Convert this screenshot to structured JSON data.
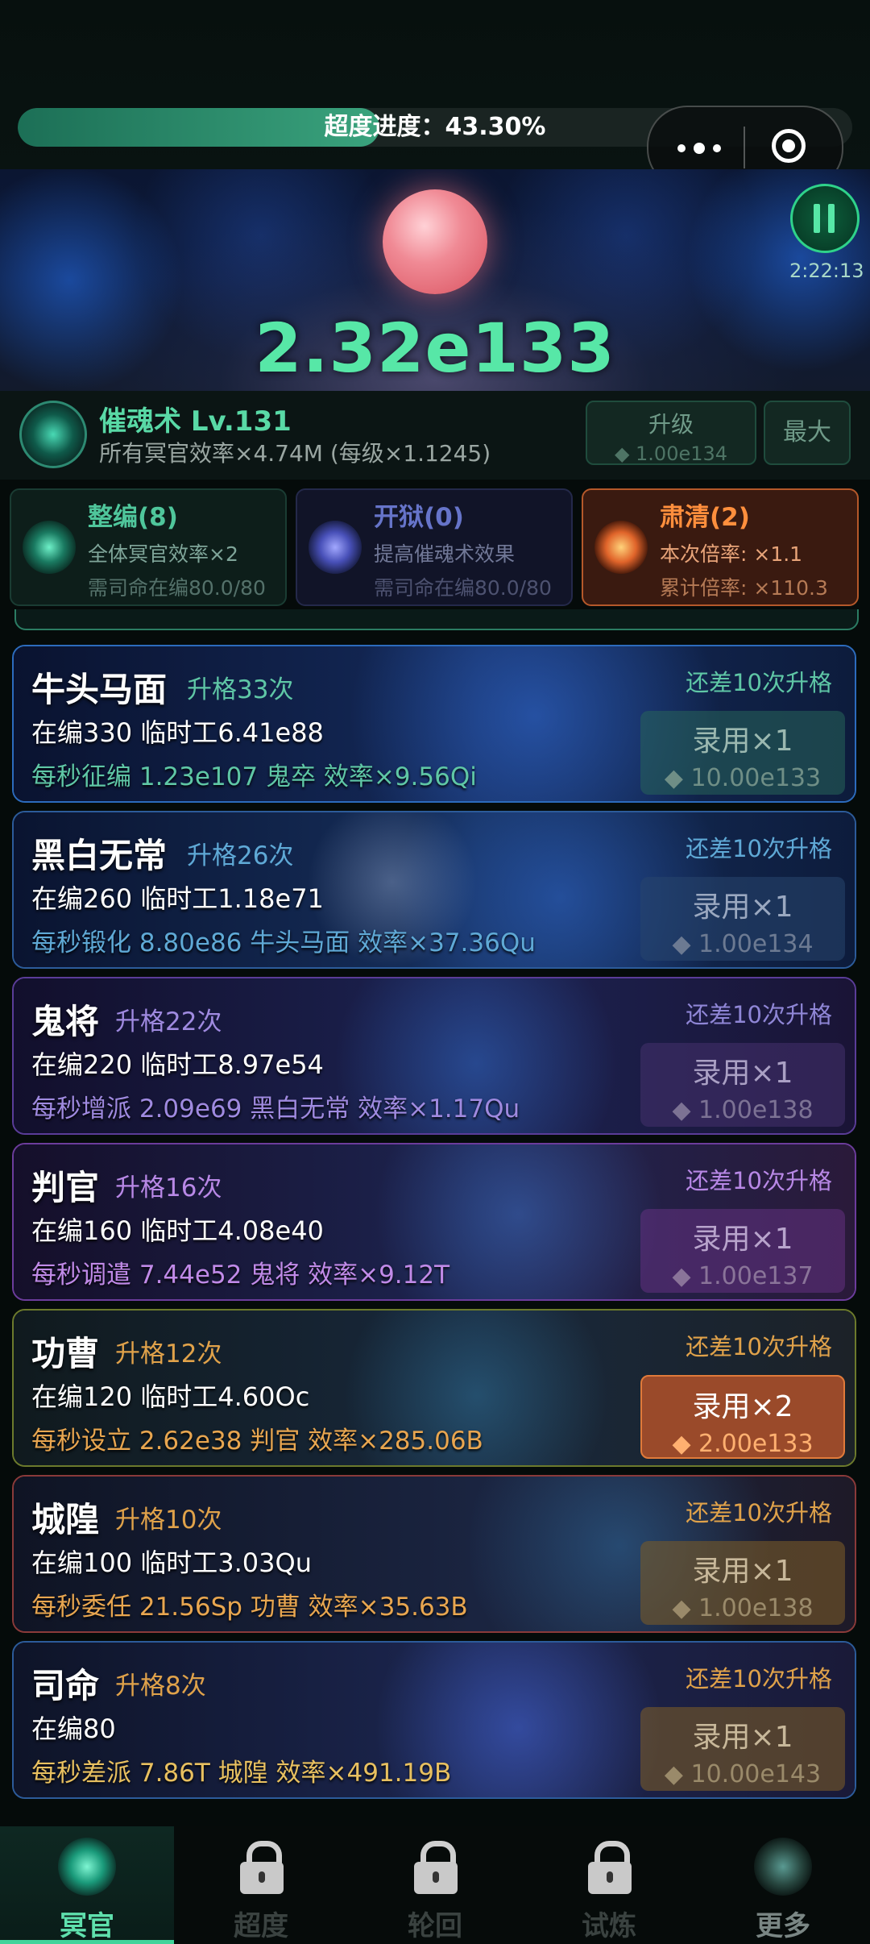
{
  "progress": {
    "label": "超度进度：43.30%",
    "value_percent": 43.3
  },
  "scene": {
    "resource_value": "2.32e133",
    "boost_timer": "2:22:13"
  },
  "skill": {
    "title": "催魂术 Lv.131",
    "desc": "所有冥官效率×4.74M (每级×1.1245)",
    "upgrade_label": "升级",
    "upgrade_cost": "◆ 1.00e134",
    "max_label": "最大"
  },
  "perks": [
    {
      "title": "整编(8)",
      "line2": "全体冥官效率×2",
      "line3": "需司命在编80.0/80"
    },
    {
      "title": "开狱(0)",
      "line2": "提高催魂术效果",
      "line3": "需司命在编80.0/80"
    },
    {
      "title": "肃清(2)",
      "line2": "本次倍率: ×1.1",
      "line3": "累计倍率: ×110.3"
    }
  ],
  "cards": [
    {
      "name": "牛头马面",
      "rank": "升格33次",
      "remain": "还差10次升格",
      "line2": "在编330   临时工6.41e88",
      "line3": "每秒征编 1.23e107 鬼卒   效率×9.56Qi",
      "hire": "录用×1",
      "cost": "◆ 10.00e133"
    },
    {
      "name": "黑白无常",
      "rank": "升格26次",
      "remain": "还差10次升格",
      "line2": "在编260   临时工1.18e71",
      "line3": "每秒锻化 8.80e86 牛头马面   效率×37.36Qu",
      "hire": "录用×1",
      "cost": "◆ 1.00e134"
    },
    {
      "name": "鬼将",
      "rank": "升格22次",
      "remain": "还差10次升格",
      "line2": "在编220   临时工8.97e54",
      "line3": "每秒增派 2.09e69 黑白无常   效率×1.17Qu",
      "hire": "录用×1",
      "cost": "◆ 1.00e138"
    },
    {
      "name": "判官",
      "rank": "升格16次",
      "remain": "还差10次升格",
      "line2": "在编160   临时工4.08e40",
      "line3": "每秒调遣 7.44e52 鬼将   效率×9.12T",
      "hire": "录用×1",
      "cost": "◆ 1.00e137"
    },
    {
      "name": "功曹",
      "rank": "升格12次",
      "remain": "还差10次升格",
      "line2": "在编120   临时工4.60Oc",
      "line3": "每秒设立 2.62e38 判官   效率×285.06B",
      "hire": "录用×2",
      "cost": "◆ 2.00e133"
    },
    {
      "name": "城隍",
      "rank": "升格10次",
      "remain": "还差10次升格",
      "line2": "在编100   临时工3.03Qu",
      "line3": "每秒委任 21.56Sp 功曹   效率×35.63B",
      "hire": "录用×1",
      "cost": "◆ 1.00e138"
    },
    {
      "name": "司命",
      "rank": "升格8次",
      "remain": "还差10次升格",
      "line2": "在编80",
      "line3": "每秒差派 7.86T 城隍   效率×491.19B",
      "hire": "录用×1",
      "cost": "◆ 10.00e143"
    }
  ],
  "nav": [
    {
      "label": "冥官",
      "icon": "ghost-official-icon"
    },
    {
      "label": "超度",
      "icon": "lock-icon"
    },
    {
      "label": "轮回",
      "icon": "lock-icon"
    },
    {
      "label": "试炼",
      "icon": "lock-icon"
    },
    {
      "label": "更多",
      "icon": "more-icon"
    }
  ]
}
